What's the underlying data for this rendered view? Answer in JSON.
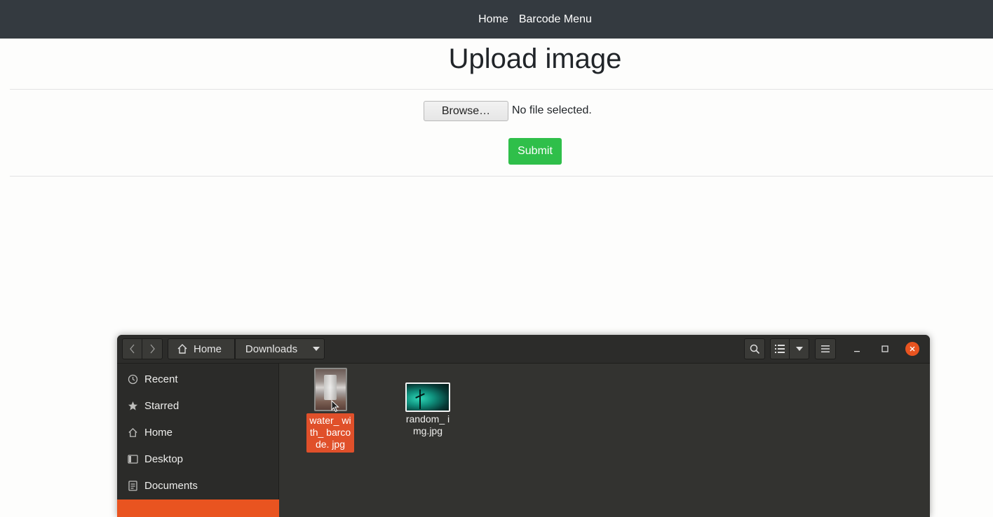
{
  "navbar": {
    "links": [
      "Home",
      "Barcode Menu"
    ],
    "bg_color": "#343a40"
  },
  "page": {
    "title": "Upload image",
    "browse_label": "Browse…",
    "file_status": "No file selected.",
    "submit_label": "Submit",
    "submit_color": "#2fbf4a"
  },
  "file_chooser": {
    "path": [
      "Home",
      "Downloads"
    ],
    "icons": {
      "back": "chevron-left-icon",
      "forward": "chevron-right-icon",
      "home": "home-icon",
      "path_dropdown": "caret-down-icon",
      "search": "search-icon",
      "view_list": "list-view-icon",
      "view_dropdown": "caret-down-icon",
      "menu": "hamburger-icon",
      "minimize": "minimize-icon",
      "maximize": "maximize-icon",
      "close": "close-icon"
    },
    "sidebar": [
      {
        "label": "Recent",
        "icon": "clock-icon"
      },
      {
        "label": "Starred",
        "icon": "star-icon"
      },
      {
        "label": "Home",
        "icon": "home-icon"
      },
      {
        "label": "Desktop",
        "icon": "desktop-icon"
      },
      {
        "label": "Documents",
        "icon": "document-icon"
      }
    ],
    "files": [
      {
        "name": "water_with_barcode.jpg",
        "display": "water_ with_ barcode. jpg",
        "selected": true
      },
      {
        "name": "random_img.jpg",
        "display": "random_ img.jpg",
        "selected": false
      }
    ],
    "accent_color": "#e95420"
  }
}
